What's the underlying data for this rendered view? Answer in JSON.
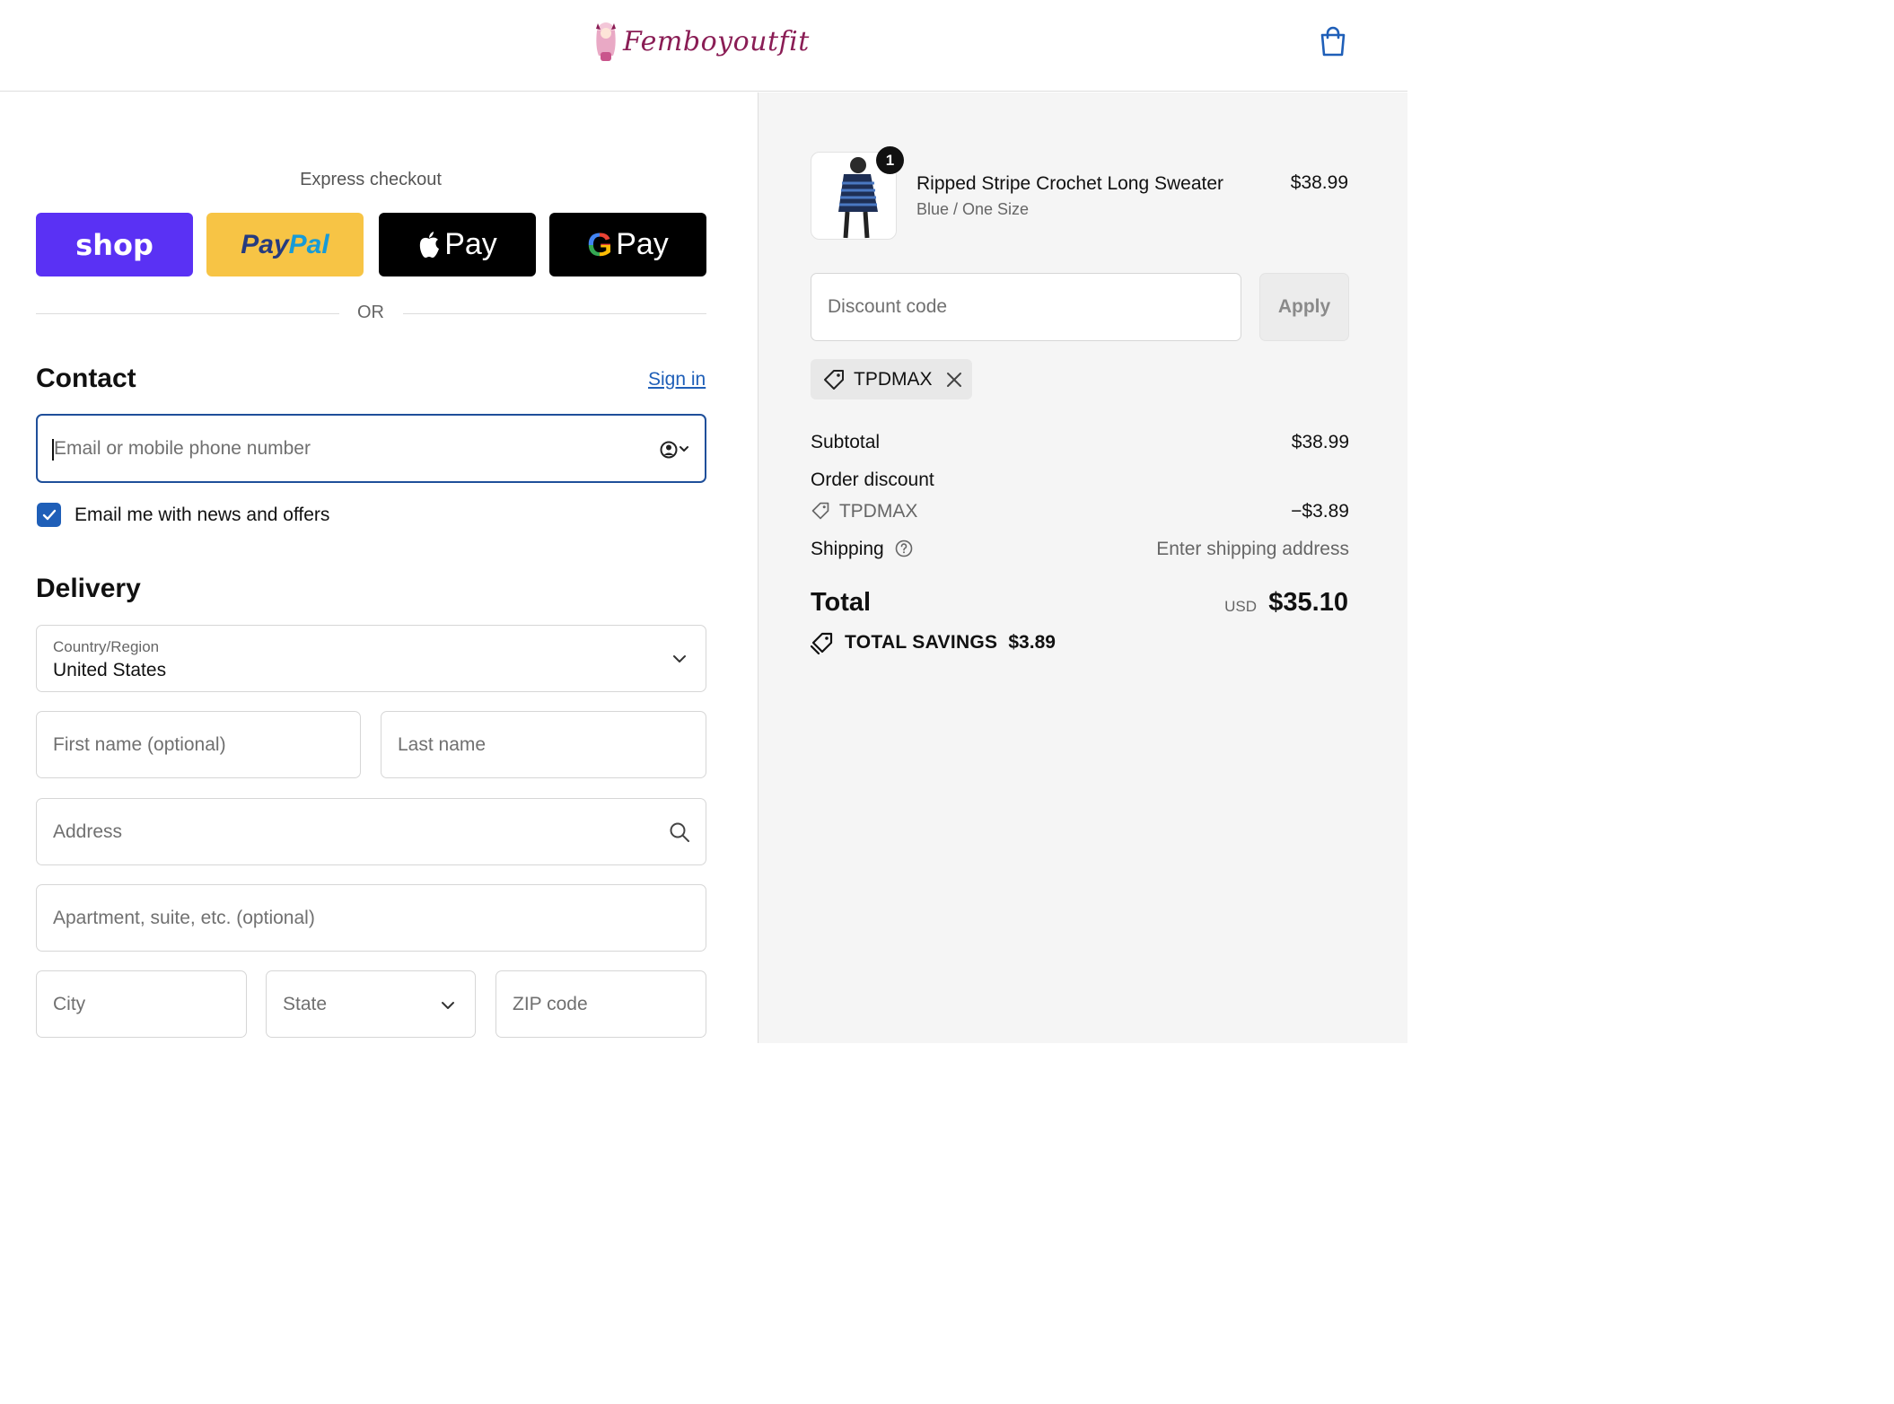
{
  "header": {
    "brand": "Femboyoutfit",
    "cart_icon": "shopping-bag-icon"
  },
  "express": {
    "title": "Express checkout",
    "shop_label": "shop",
    "paypal_label_1": "Pay",
    "paypal_label_2": "Pal",
    "apple_pay_label": "Pay",
    "google_pay_g": "G",
    "google_pay_label": "Pay",
    "or_text": "OR"
  },
  "contact": {
    "title": "Contact",
    "sign_in": "Sign in",
    "email_placeholder": "Email or mobile phone number",
    "newsletter_label": "Email me with news and offers",
    "newsletter_checked": true
  },
  "delivery": {
    "title": "Delivery",
    "country_label": "Country/Region",
    "country_value": "United States",
    "first_name_placeholder": "First name (optional)",
    "last_name_placeholder": "Last name",
    "address_placeholder": "Address",
    "apartment_placeholder": "Apartment, suite, etc. (optional)",
    "city_placeholder": "City",
    "state_placeholder": "State",
    "zip_placeholder": "ZIP code"
  },
  "order": {
    "item": {
      "quantity": "1",
      "name": "Ripped Stripe Crochet Long Sweater",
      "variant": "Blue / One Size",
      "price": "$38.99"
    },
    "discount_placeholder": "Discount code",
    "apply_label": "Apply",
    "applied_code": "TPDMAX",
    "subtotal_label": "Subtotal",
    "subtotal_value": "$38.99",
    "order_discount_label": "Order discount",
    "discount_code": "TPDMAX",
    "discount_value": "−$3.89",
    "shipping_label": "Shipping",
    "shipping_value": "Enter shipping address",
    "total_label": "Total",
    "currency": "USD",
    "total_value": "$35.10",
    "savings_label": "TOTAL SAVINGS",
    "savings_value": "$3.89"
  },
  "colors": {
    "shop_pay": "#5a31f4",
    "paypal": "#f7c445",
    "link": "#1f5fb8",
    "focus_border": "#1f4f9a",
    "brand": "#8a1d55"
  }
}
